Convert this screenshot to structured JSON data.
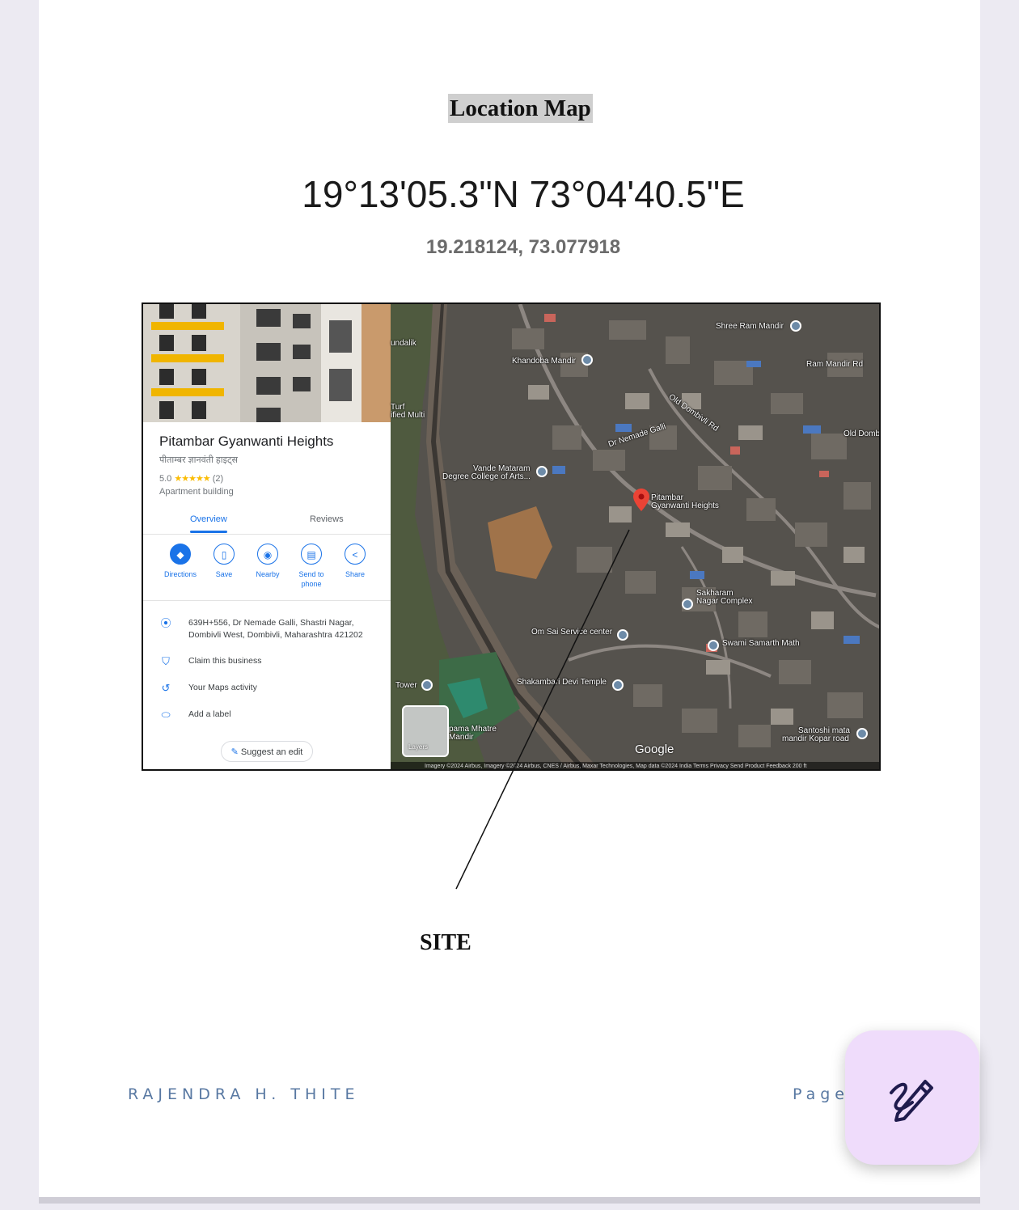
{
  "document": {
    "title": "Location Map",
    "coordinates_dms": "19°13'05.3\"N 73°04'40.5\"E",
    "coordinates_decimal": "19.218124, 73.077918",
    "site_label": "SITE",
    "footer": {
      "author": "RAJENDRA H. THITE",
      "page_label": "Page"
    }
  },
  "map_panel": {
    "place_name": "Pitambar Gyanwanti Heights",
    "place_name_local": "पीताम्बर ज्ञानवंती हाइट्स",
    "rating": "5.0",
    "stars": "★★★★★",
    "review_count": "(2)",
    "place_type": "Apartment building",
    "tabs": [
      "Overview",
      "Reviews"
    ],
    "actions": [
      "Directions",
      "Save",
      "Nearby",
      "Send to phone",
      "Share"
    ],
    "address": "639H+556, Dr Nemade Galli, Shastri Nagar, Dombivli West, Dombivli, Maharashtra 421202",
    "claim": "Claim this business",
    "maps_activity": "Your Maps activity",
    "add_label": "Add a label",
    "suggest_edit": "Suggest an edit"
  },
  "map": {
    "labels": {
      "shree_ram_mandir": "Shree Ram Mandir",
      "khandoba_mandir": "Khandoba Mandir",
      "ram_mandir_rd": "Ram Mandir Rd",
      "old_dombivli_rd": "Old Dombivli Rd",
      "old_domb": "Old Domb",
      "dr_nemade_galli": "Dr Nemade Galli",
      "vande_mataram": "Vande Mataram",
      "degree_college": "Degree College of Arts...",
      "pitambar_1": "Pitambar",
      "pitambar_2": "Gyanwanti Heights",
      "sakharam_1": "Sakharam",
      "sakharam_2": "Nagar Complex",
      "om_sai": "Om Sai Service center",
      "swami_samarth": "Swami Samarth Math",
      "shakambari": "Shakambari Devi Temple",
      "tower": "Tower",
      "mhatre_1": "pama Mhatre",
      "mhatre_2": "Mandir",
      "santoshi_1": "Santoshi mata",
      "santoshi_2": "mandir Kopar road",
      "undalik": "undalik",
      "turf_1": "Turf",
      "turf_2": "ified Multi"
    },
    "layers_label": "Layers",
    "google_logo": "Google",
    "attribution": "Imagery ©2024 Airbus, Imagery ©2024 Airbus, CNES / Airbus, Maxar Technologies, Map data ©2024    India    Terms    Privacy    Send Product Feedback    200 ft"
  },
  "colors": {
    "accent_blue": "#1a73e8",
    "footer_text": "#5878a2",
    "fab_background": "#efdcfb",
    "pin_red": "#ea4335"
  },
  "icons": {
    "fab": "edit-pen-icon"
  }
}
